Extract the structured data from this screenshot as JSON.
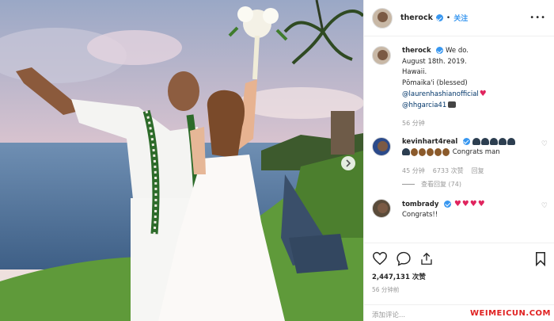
{
  "post": {
    "username": "therock",
    "follow_label": "关注",
    "separator": "•",
    "more_glyph": "•••"
  },
  "caption": {
    "username": "therock",
    "line1": "We do.",
    "line2": "August 18th. 2019.",
    "line3": "Hawaii.",
    "line4": "Pōmaika'i (blessed)",
    "mention1": "@laurenhashianofficial",
    "mention2": "@hhgarcia41",
    "time": "56 分钟"
  },
  "comments": [
    {
      "username": "kevinhart4real",
      "text": "Congrats man",
      "time": "45 分钟",
      "likes": "6733 次赞",
      "reply_label": "回复",
      "view_replies": "查看回复 (74)"
    },
    {
      "username": "tombrady",
      "text": "Congrats!!"
    }
  ],
  "stats": {
    "likes": "2,447,131 次赞",
    "ago": "56 分钟前"
  },
  "add_comment_placeholder": "添加评论...",
  "watermark": "WEIMEICUN.COM",
  "colors": {
    "accent": "#3897f0",
    "heart": "#e0245e",
    "watermark": "#e02020"
  }
}
